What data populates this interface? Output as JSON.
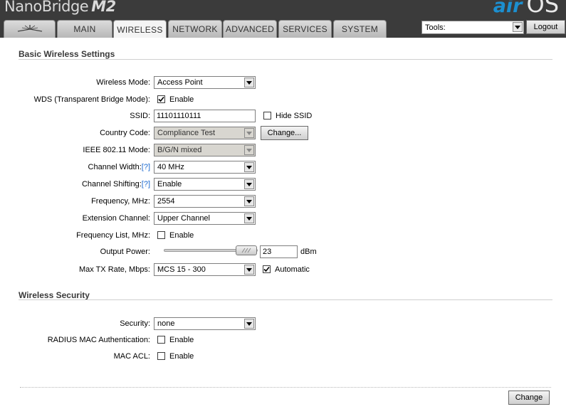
{
  "header": {
    "product_name": "NanoBridge",
    "model": "M2",
    "brand_prefix": "air",
    "brand_suffix": "OS"
  },
  "tabs": [
    {
      "label": "",
      "icon": "ubiquiti-logo-icon"
    },
    {
      "label": "MAIN"
    },
    {
      "label": "WIRELESS",
      "active": true
    },
    {
      "label": "NETWORK"
    },
    {
      "label": "ADVANCED"
    },
    {
      "label": "SERVICES"
    },
    {
      "label": "SYSTEM"
    }
  ],
  "tools": {
    "selected": "Tools:"
  },
  "logout_label": "Logout",
  "basic": {
    "title": "Basic Wireless Settings",
    "wireless_mode": {
      "label": "Wireless Mode:",
      "value": "Access Point"
    },
    "wds": {
      "label": "WDS (Transparent Bridge Mode):",
      "checkbox_label": "Enable",
      "checked": true
    },
    "ssid": {
      "label": "SSID:",
      "value": "11101110111",
      "hide_label": "Hide SSID",
      "hide_checked": false
    },
    "country": {
      "label": "Country Code:",
      "value": "Compliance Test",
      "change_label": "Change..."
    },
    "ieee_mode": {
      "label": "IEEE 802.11 Mode:",
      "value": "B/G/N mixed"
    },
    "channel_width": {
      "label": "Channel Width:",
      "help": "[?]",
      "value": "40 MHz"
    },
    "channel_shifting": {
      "label": "Channel Shifting:",
      "help": "[?]",
      "value": "Enable"
    },
    "frequency": {
      "label": "Frequency, MHz:",
      "value": "2554"
    },
    "extension_channel": {
      "label": "Extension Channel:",
      "value": "Upper Channel"
    },
    "frequency_list": {
      "label": "Frequency List, MHz:",
      "checkbox_label": "Enable",
      "checked": false
    },
    "output_power": {
      "label": "Output Power:",
      "value": "23",
      "unit": "dBm"
    },
    "max_tx_rate": {
      "label": "Max TX Rate, Mbps:",
      "value": "MCS 15 - 300",
      "auto_label": "Automatic",
      "auto_checked": true
    }
  },
  "security": {
    "title": "Wireless Security",
    "security_mode": {
      "label": "Security:",
      "value": "none"
    },
    "radius_mac": {
      "label": "RADIUS MAC Authentication:",
      "checkbox_label": "Enable",
      "checked": false
    },
    "mac_acl": {
      "label": "MAC ACL:",
      "checkbox_label": "Enable",
      "checked": false
    }
  },
  "change_label": "Change",
  "colors": {
    "header_bg": "#3b3b3b",
    "brand_blue": "#1c8fd0",
    "help_link": "#1c6ad0"
  }
}
